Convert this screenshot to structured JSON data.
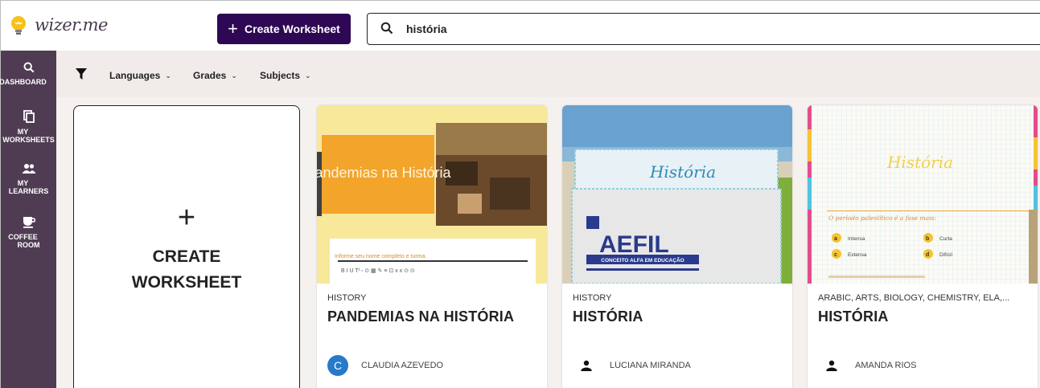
{
  "app": {
    "logo_text": "wizer.me"
  },
  "header": {
    "create_label": "Create Worksheet",
    "search_value": "história"
  },
  "sidebar": {
    "items": [
      {
        "label": "DASHBOARD",
        "icon": "search-icon"
      },
      {
        "label": "MY\nWORKSHEETS",
        "icon": "copy-icon"
      },
      {
        "label": "MY\nLEARNERS",
        "icon": "people-icon"
      },
      {
        "label": "COFFEE\nROOM",
        "icon": "coffee-icon"
      }
    ]
  },
  "filters": {
    "languages": "Languages",
    "grades": "Grades",
    "subjects": "Subjects"
  },
  "create_card": {
    "label": "CREATE\nWORKSHEET"
  },
  "cards": [
    {
      "subject": "HISTORY",
      "title": "PANDEMIAS NA HISTÓRIA",
      "author": "CLAUDIA AZEVEDO",
      "avatar_letter": "C",
      "thumb_title": "Pandemias na História",
      "thumb_prompt": "Informe seu nome completo e turma."
    },
    {
      "subject": "HISTORY",
      "title": "HISTÓRIA",
      "author": "LUCIANA MIRANDA",
      "thumb_title": "História",
      "thumb_logo": "AEFIL",
      "thumb_tagline": "CONCEITO ALFA EM EDUCAÇÃO"
    },
    {
      "subject": "ARABIC, ARTS, BIOLOGY, CHEMISTRY, ELA,...",
      "title": "HISTÓRIA",
      "author": "AMANDA RIOS",
      "thumb_title": "História",
      "thumb_question": "O período paleolítico é a fase mais:",
      "thumb_options": [
        {
          "letter": "a",
          "text": "Intensa"
        },
        {
          "letter": "b",
          "text": "Curta"
        },
        {
          "letter": "c",
          "text": "Extensa"
        },
        {
          "letter": "d",
          "text": "Difícil"
        }
      ]
    }
  ],
  "colors": {
    "brand_dark": "#2e0854",
    "sidebar": "#4f3c53",
    "filter_bg": "#f1ece9",
    "avatar_blue": "#2779c9"
  }
}
